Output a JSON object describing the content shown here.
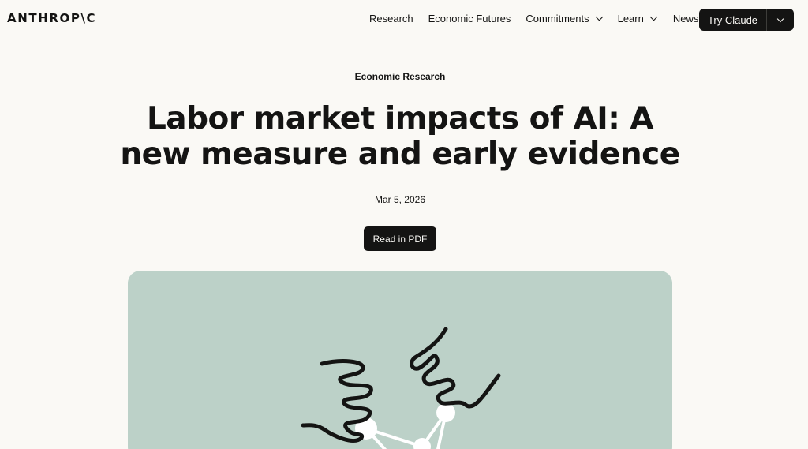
{
  "header": {
    "logo": "ANTHROP\\C",
    "nav": [
      {
        "label": "Research",
        "has_dropdown": false
      },
      {
        "label": "Economic Futures",
        "has_dropdown": false
      },
      {
        "label": "Commitments",
        "has_dropdown": true
      },
      {
        "label": "Learn",
        "has_dropdown": true
      },
      {
        "label": "News",
        "has_dropdown": false
      }
    ],
    "cta_label": "Try Claude"
  },
  "article": {
    "category": "Economic Research",
    "title": "Labor market impacts of AI: A new measure and early evidence",
    "date": "Mar 5, 2026",
    "pdf_button": "Read in PDF"
  },
  "colors": {
    "background": "#faf9f5",
    "ink": "#141413",
    "illustration_bg": "#bcd1c8",
    "node": "#ffffff"
  },
  "illustration": {
    "icon": "hands-network-illustration"
  }
}
